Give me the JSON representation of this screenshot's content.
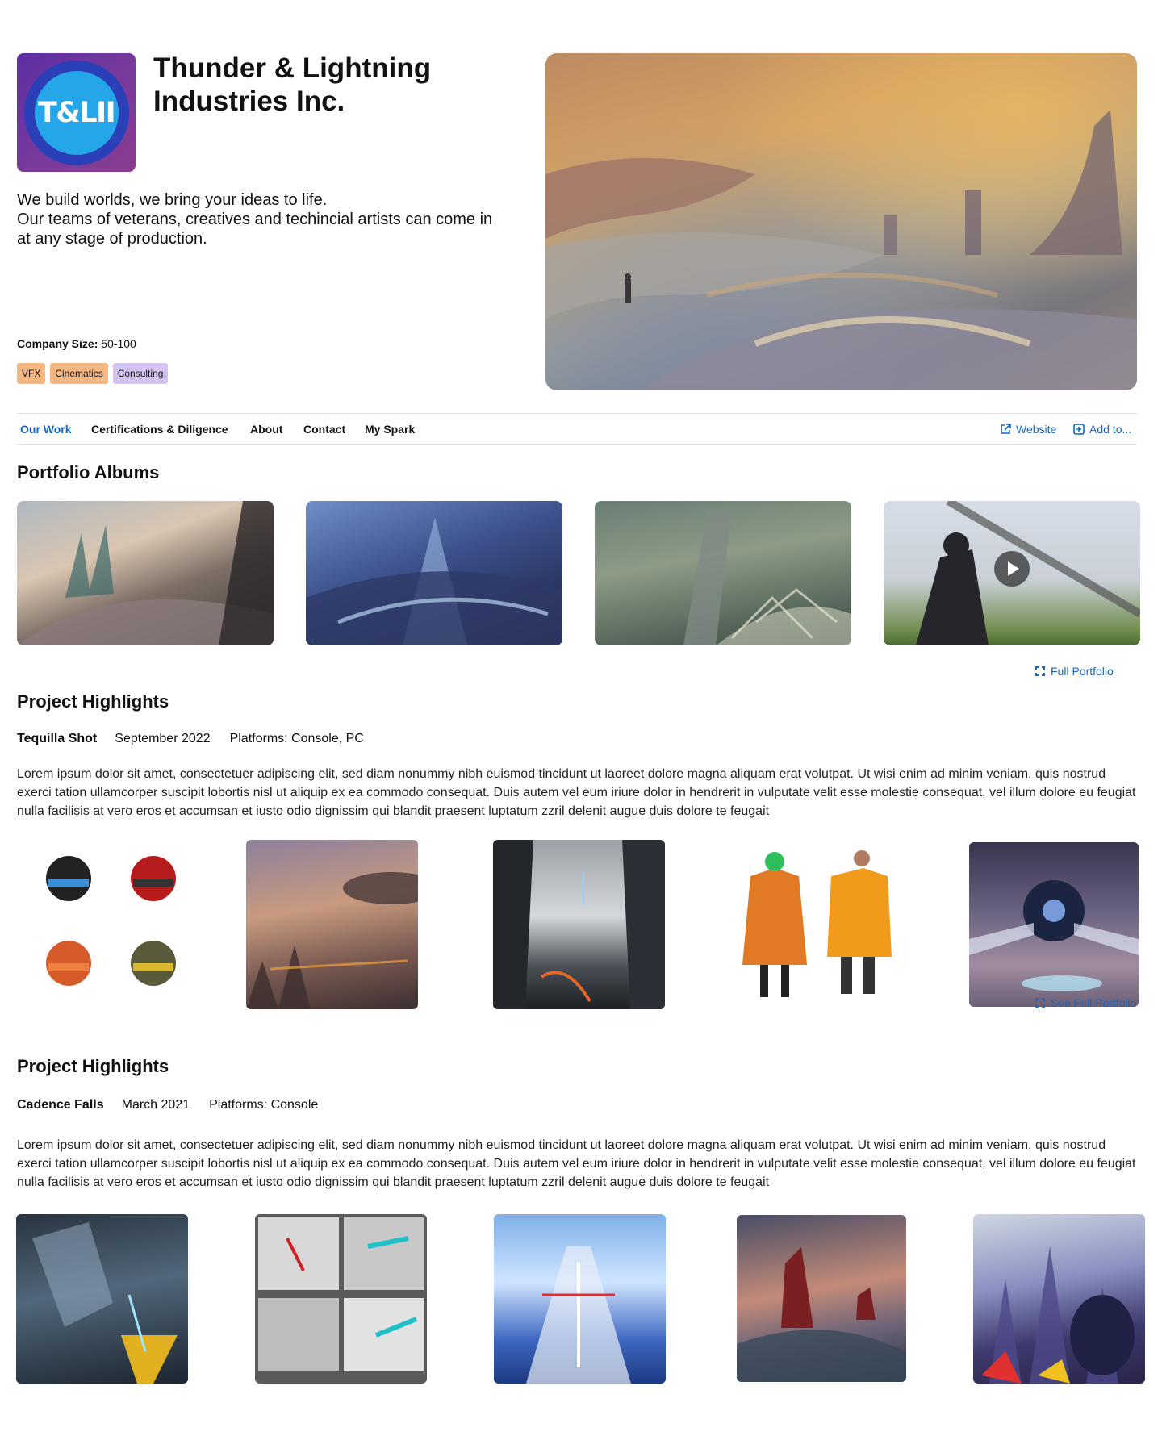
{
  "company": {
    "logo_text": "T&LII",
    "name": "Thunder & Lightning Industries Inc.",
    "tagline": "We build worlds, we bring your ideas to life.\nOur teams of veterans, creatives and techincial artists can come in at any stage of production.",
    "size_label": "Company Size:",
    "size_value": "50-100",
    "tags": [
      {
        "label": "VFX",
        "color": "#f6b882"
      },
      {
        "label": "Cinematics",
        "color": "#f6b882"
      },
      {
        "label": "Consulting",
        "color": "#d4c4f2"
      }
    ],
    "hero_alt_icon": "concept-art-image"
  },
  "nav": {
    "tabs": [
      "Our Work",
      "Certifications & Diligence",
      "About",
      "Contact",
      "My Spark"
    ],
    "active_tab": "Our Work",
    "website_label": "Website",
    "add_label": "Add to...",
    "website_icon": "external-link-icon",
    "add_icon": "add-square-icon"
  },
  "portfolio": {
    "title": "Portfolio Albums",
    "full_link": "Full Portfolio",
    "link_icon": "expand-icon",
    "albums": [
      {
        "name": "album-city-canyon",
        "video": false
      },
      {
        "name": "album-blue-megastructure",
        "video": false
      },
      {
        "name": "album-green-lattice",
        "video": false
      },
      {
        "name": "album-suited-figure",
        "video": true
      }
    ]
  },
  "highlights": [
    {
      "title": "Project Highlights",
      "project": "Tequilla Shot",
      "date": "September 2022",
      "platforms": "Platforms: Console, PC",
      "description": "Lorem ipsum dolor sit amet, consectetuer adipiscing elit, sed diam nonummy nibh euismod tincidunt ut laoreet dolore magna aliquam erat volutpat. Ut wisi enim ad minim veniam, quis nostrud exerci tation ullamcorper suscipit lobortis nisl ut aliquip ex ea commodo consequat. Duis autem vel eum iriure dolor in hendrerit in vulputate velit esse molestie consequat, vel illum dolore eu feugiat nulla facilisis at vero eros et accumsan et iusto odio dignissim qui blandit praesent luptatum zzril delenit augue duis dolore te feugait",
      "see_full": "See Full Portfolio"
    },
    {
      "title": "Project Highlights",
      "project": "Cadence Falls",
      "date": "March 2021",
      "platforms": "Platforms: Console",
      "description": "Lorem ipsum dolor sit amet, consectetuer adipiscing elit, sed diam nonummy nibh euismod tincidunt ut laoreet dolore magna aliquam erat volutpat. Ut wisi enim ad minim veniam, quis nostrud exerci tation ullamcorper suscipit lobortis nisl ut aliquip ex ea commodo consequat. Duis autem vel eum iriure dolor in hendrerit in vulputate velit esse molestie consequat, vel illum dolore eu feugiat nulla facilisis at vero eros et accumsan et iusto odio dignissim qui blandit praesent luptatum zzril delenit augue duis dolore te feugait"
    }
  ],
  "colors": {
    "accent": "#1565c0",
    "text": "#111111",
    "divider": "#e2e2e2"
  }
}
